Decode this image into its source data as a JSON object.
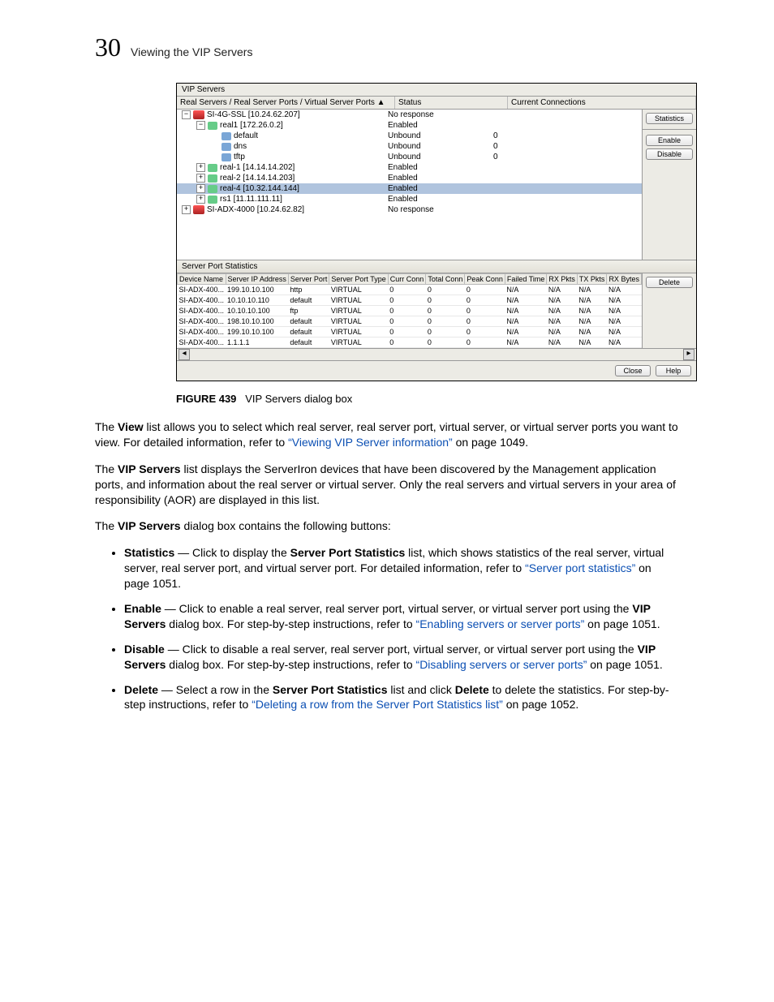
{
  "header": {
    "page_number": "30",
    "section_title": "Viewing the VIP Servers"
  },
  "dialog": {
    "title": "VIP Servers",
    "tree_columns": {
      "c1": "Real Servers / Real Server Ports / Virtual Server Ports  ▲",
      "c2": "Status",
      "c3": "Current Connections"
    },
    "buttons": {
      "statistics": "Statistics",
      "enable": "Enable",
      "disable": "Disable",
      "delete": "Delete",
      "close": "Close",
      "help": "Help"
    },
    "tree_rows": [
      {
        "indent": 0,
        "exp": "⊟",
        "icon": "bigdev",
        "label": "SI-4G-SSL [10.24.62.207]",
        "status": "No response",
        "conn": ""
      },
      {
        "indent": 1,
        "exp": "⊟",
        "icon": "server",
        "label": "real1 [172.26.0.2]",
        "status": "Enabled",
        "conn": ""
      },
      {
        "indent": 2,
        "exp": "",
        "icon": "port",
        "label": "default",
        "status": "Unbound",
        "conn": "0"
      },
      {
        "indent": 2,
        "exp": "",
        "icon": "port",
        "label": "dns",
        "status": "Unbound",
        "conn": "0"
      },
      {
        "indent": 2,
        "exp": "",
        "icon": "port",
        "label": "tftp",
        "status": "Unbound",
        "conn": "0"
      },
      {
        "indent": 1,
        "exp": "⊞",
        "icon": "server",
        "label": "real-1 [14.14.14.202]",
        "status": "Enabled",
        "conn": ""
      },
      {
        "indent": 1,
        "exp": "⊞",
        "icon": "server",
        "label": "real-2 [14.14.14.203]",
        "status": "Enabled",
        "conn": ""
      },
      {
        "indent": 1,
        "exp": "⊞",
        "icon": "server",
        "label": "real-4 [10.32.144.144]",
        "status": "Enabled",
        "conn": "",
        "selected": true
      },
      {
        "indent": 1,
        "exp": "⊞",
        "icon": "server",
        "label": "rs1 [11.11.111.11]",
        "status": "Enabled",
        "conn": ""
      },
      {
        "indent": 0,
        "exp": "⊞",
        "icon": "bigdev",
        "label": "SI-ADX-4000 [10.24.62.82]",
        "status": "No response",
        "conn": ""
      }
    ],
    "stats_header": "Server Port Statistics",
    "stat_cols": [
      "Device Name",
      "Server IP Address",
      "Server Port",
      "Server Port Type",
      "Curr Conn",
      "Total Conn",
      "Peak Conn",
      "Failed Time",
      "RX Pkts",
      "TX Pkts",
      "RX Bytes"
    ],
    "stat_rows": [
      [
        "SI-ADX-400...",
        "199.10.10.100",
        "http",
        "VIRTUAL",
        "0",
        "0",
        "0",
        "N/A",
        "N/A",
        "N/A",
        "N/A"
      ],
      [
        "SI-ADX-400...",
        "10.10.10.110",
        "default",
        "VIRTUAL",
        "0",
        "0",
        "0",
        "N/A",
        "N/A",
        "N/A",
        "N/A"
      ],
      [
        "SI-ADX-400...",
        "10.10.10.100",
        "ftp",
        "VIRTUAL",
        "0",
        "0",
        "0",
        "N/A",
        "N/A",
        "N/A",
        "N/A"
      ],
      [
        "SI-ADX-400...",
        "198.10.10.100",
        "default",
        "VIRTUAL",
        "0",
        "0",
        "0",
        "N/A",
        "N/A",
        "N/A",
        "N/A"
      ],
      [
        "SI-ADX-400...",
        "199.10.10.100",
        "default",
        "VIRTUAL",
        "0",
        "0",
        "0",
        "N/A",
        "N/A",
        "N/A",
        "N/A"
      ],
      [
        "SI-ADX-400...",
        "1.1.1.1",
        "default",
        "VIRTUAL",
        "0",
        "0",
        "0",
        "N/A",
        "N/A",
        "N/A",
        "N/A"
      ]
    ]
  },
  "figure": {
    "label": "FIGURE 439",
    "caption": "VIP Servers dialog box"
  },
  "para1_a": "The ",
  "para1_b": "View",
  "para1_c": " list allows you to select which real server, real server port, virtual server, or virtual server ports you want to view. For detailed information, refer to ",
  "para1_link": "“Viewing VIP Server information”",
  "para1_d": " on page 1049.",
  "para2_a": "The ",
  "para2_b": "VIP Servers",
  "para2_c": " list displays the ServerIron devices that have been discovered by the Management application ports, and information about the real server or virtual server. Only the real servers and virtual servers in your area of responsibility (AOR) are displayed in this list.",
  "para3_a": "The ",
  "para3_b": "VIP Servers",
  "para3_c": " dialog box contains the following buttons:",
  "bullets": [
    {
      "lead": "Statistics",
      "t1": " — Click to display the ",
      "b1": "Server Port Statistics",
      "t2": " list, which shows statistics of the real server, virtual server, real server port, and virtual server port. For detailed information, refer to ",
      "link": "“Server port statistics”",
      "t3": " on page 1051."
    },
    {
      "lead": "Enable",
      "t1": " — Click to enable a real server, real server port, virtual server, or virtual server port using the ",
      "b1": "VIP Servers",
      "t2": " dialog box. For step-by-step instructions, refer to ",
      "link": "“Enabling servers or server ports”",
      "t3": " on page 1051."
    },
    {
      "lead": "Disable",
      "t1": " — Click to disable a real server, real server port, virtual server, or virtual server port using the ",
      "b1": "VIP Servers",
      "t2": " dialog box. For step-by-step instructions, refer to ",
      "link": "“Disabling servers or server ports”",
      "t3": " on page 1051."
    },
    {
      "lead": "Delete",
      "t1": " — Select a row in the ",
      "b1": "Server Port Statistics",
      "t2": " list and click ",
      "b2": "Delete",
      "t3": " to delete the statistics. For step-by-step instructions, refer to ",
      "link": "“Deleting a row from the Server Port Statistics list”",
      "t4": " on page 1052."
    }
  ]
}
